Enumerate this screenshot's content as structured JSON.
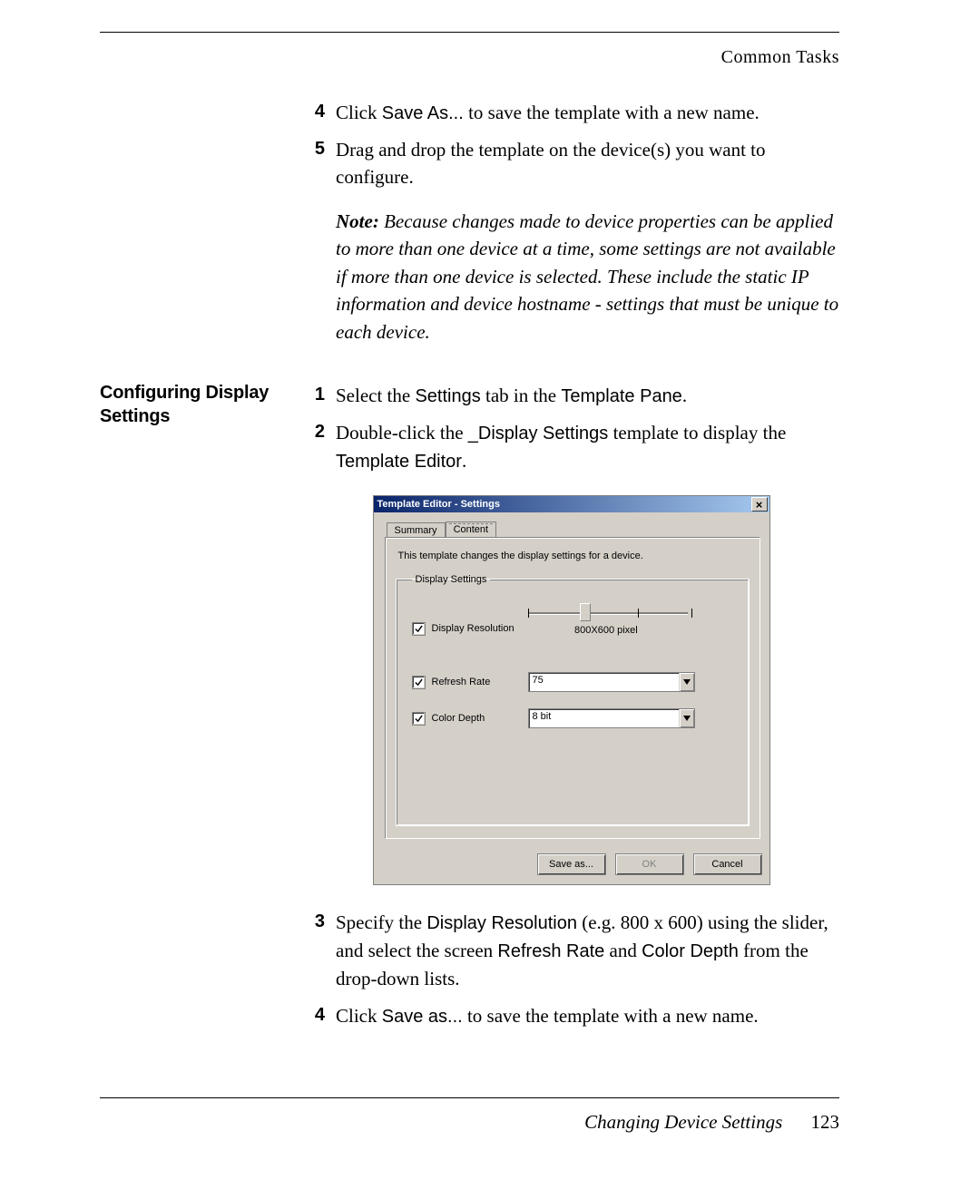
{
  "header": {
    "running_head": "Common Tasks"
  },
  "topSteps": [
    {
      "num": "4",
      "parts": [
        {
          "t": "Click "
        },
        {
          "t": "Save As...",
          "ui": true
        },
        {
          "t": " to save the template with a new name."
        }
      ]
    },
    {
      "num": "5",
      "parts": [
        {
          "t": "Drag and drop the template on the device(s) you want to configure."
        }
      ]
    }
  ],
  "note": {
    "prefix": "Note:",
    "body": " Because changes made to device properties can be applied to more than one device at a time, some settings are not available if more than one device is selected. These include the static IP information and device hostname - settings that must be unique to each device."
  },
  "section": {
    "heading_line1": "Configuring Display",
    "heading_line2": "Settings",
    "steps": [
      {
        "num": "1",
        "parts": [
          {
            "t": "Select the "
          },
          {
            "t": "Settings",
            "ui": true
          },
          {
            "t": " tab in the "
          },
          {
            "t": "Template Pane",
            "ui": true
          },
          {
            "t": "."
          }
        ]
      },
      {
        "num": "2",
        "parts": [
          {
            "t": "Double-click the "
          },
          {
            "t": "_Display Settings",
            "ui": true
          },
          {
            "t": " template to display the "
          },
          {
            "t": "Template Editor",
            "ui": true
          },
          {
            "t": "."
          }
        ]
      }
    ],
    "stepsAfter": [
      {
        "num": "3",
        "parts": [
          {
            "t": "Specify the "
          },
          {
            "t": "Display Resolution",
            "ui": true
          },
          {
            "t": " (e.g. 800 x 600) using the slider, and select the screen "
          },
          {
            "t": "Refresh Rate",
            "ui": true
          },
          {
            "t": " and "
          },
          {
            "t": "Color Depth",
            "ui": true
          },
          {
            "t": " from the drop-down lists."
          }
        ]
      },
      {
        "num": "4",
        "parts": [
          {
            "t": "Click "
          },
          {
            "t": "Save as...",
            "ui": true
          },
          {
            "t": " to save the template with a new name."
          }
        ]
      }
    ]
  },
  "dialog": {
    "title": "Template Editor - Settings",
    "tabs": {
      "summary": "Summary",
      "content": "Content"
    },
    "desc": "This template changes the display settings for a device.",
    "group": "Display Settings",
    "rows": {
      "resolution": {
        "label": "Display Resolution",
        "value": "800X600 pixel",
        "checked": true
      },
      "refresh": {
        "label": "Refresh Rate",
        "value": "75",
        "checked": true
      },
      "depth": {
        "label": "Color Depth",
        "value": "8 bit",
        "checked": true
      }
    },
    "buttons": {
      "save": "Save as...",
      "ok": "OK",
      "cancel": "Cancel"
    }
  },
  "footer": {
    "section": "Changing Device Settings",
    "page": "123"
  }
}
